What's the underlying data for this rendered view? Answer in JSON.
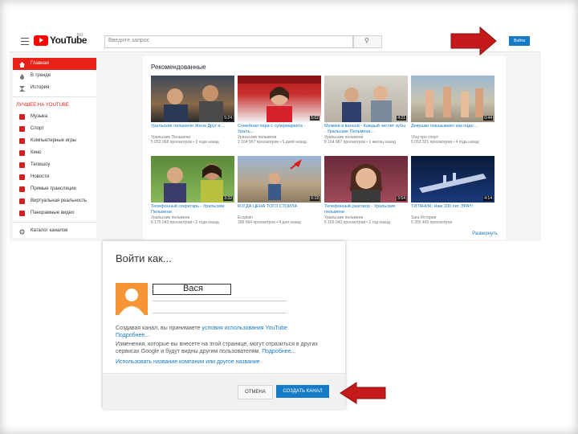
{
  "header": {
    "logo_text": "YouTube",
    "logo_region": "RU",
    "search_placeholder": "Введите запрос",
    "signin_label": "Войти"
  },
  "sidebar": {
    "items": [
      {
        "label": "Главная",
        "icon": "home-icon",
        "active": true
      },
      {
        "label": "В тренде",
        "icon": "flame-icon",
        "active": false
      },
      {
        "label": "История",
        "icon": "hourglass-icon",
        "active": false
      }
    ],
    "section_title": "ЛУЧШЕЕ НА YOUTUBE",
    "channels": [
      "Музыка",
      "Спорт",
      "Компьютерные игры",
      "Кино",
      "Телешоу",
      "Новости",
      "Прямые трансляции",
      "Виртуальная реальность",
      "Панорамные видео"
    ],
    "more_label": "Каталог каналов"
  },
  "feed": {
    "title": "Рекомендованные",
    "videos": [
      {
        "title": "Уральские пельмени Жена Друг и ...",
        "channel": "Уральские Пельмени",
        "meta": "5 052 068 просмотров • 3 года назад",
        "duration": "5:24"
      },
      {
        "title": "Семейная пара с супермаркета - Ураль...",
        "channel": "Уральские пельмени",
        "meta": "2 164 967 просмотров • 5 дней назад",
        "duration": "5:02"
      },
      {
        "title": "Мужики в ванной - Каждый чистит зубы - Уральские Пельмени...",
        "channel": "Уральские пельмени",
        "meta": "8 164 987 просмотров • 1 месяц назад",
        "duration": "4:21"
      },
      {
        "title": "Девушки показывают как надо ...",
        "channel": "Vlog про спорт",
        "meta": "5 053 321 просмотров • 4 года назад",
        "duration": "0:44"
      },
      {
        "title": "Телефонный секретарь - Уральские Пельмени",
        "channel": "Уральские пельмени",
        "meta": "8 175 043 просмотров • 2 года назад",
        "duration": "3:32"
      },
      {
        "title": "КОГДА ЦЕНА ТОГО СТОИЛА",
        "channel": "Ecsplain",
        "meta": "395 564 просмотров • 4 дня назад",
        "duration": "6:18"
      },
      {
        "title": "Телефонный разговор - Уральские пельмени",
        "channel": "Уральские пельмени",
        "meta": "5 165 042 просмотров • 1 год назад",
        "duration": "3:54"
      },
      {
        "title": "ТИТАНИК: Нам 100 лет ЭРА!!!",
        "channel": "Sara История",
        "meta": "5 355 400 просмотров",
        "duration": "4:14"
      }
    ],
    "expand_label": "Развернуть"
  },
  "dialog": {
    "title": "Войти как...",
    "name": "Вася",
    "paragraphs": [
      {
        "text": "Создавая канал, вы принимаете ",
        "link": "условия использования YouTube"
      },
      {
        "text": "",
        "link": "Подробнее..."
      },
      {
        "text": "Изменения, которые вы внесете на этой странице, могут отразиться в других сервисах Google и будут видны другим пользователям. ",
        "link": "Подробнее..."
      },
      {
        "text": "",
        "link": "Использовать название компании или другое название"
      }
    ],
    "cancel_label": "ОТМЕНА",
    "create_label": "СОЗДАТЬ КАНАЛ"
  },
  "colors": {
    "youtube_red": "#ff0000",
    "accent_blue": "#167ac6",
    "arrow_red": "#d41a1a",
    "avatar_orange": "#f59536"
  }
}
